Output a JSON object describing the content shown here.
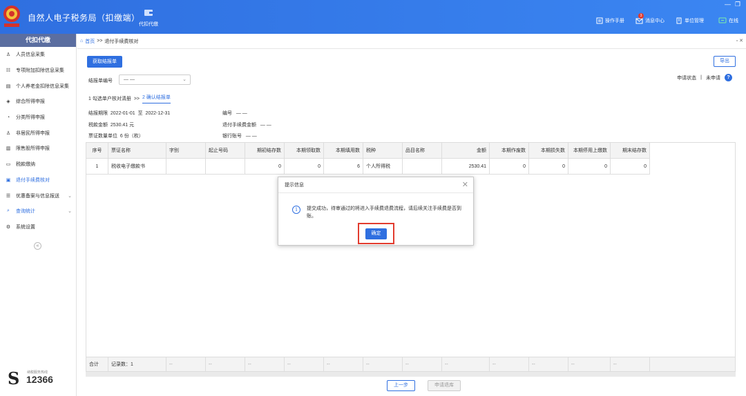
{
  "app": {
    "title": "自然人电子税务局（扣缴端）",
    "nav_tab": "代扣代缴",
    "toolbar": [
      {
        "icon": "manual-icon",
        "label": "操作手册"
      },
      {
        "icon": "message-icon",
        "label": "消息中心",
        "badge": "3"
      },
      {
        "icon": "building-icon",
        "label": "单位管理"
      },
      {
        "icon": "online-icon",
        "label": "在线"
      }
    ],
    "colors": {
      "primary": "#2f6fe0",
      "sidebar_header": "#5b6ea0",
      "highlight": "#e23b2e"
    }
  },
  "sidebar": {
    "header": "代扣代缴",
    "items": [
      {
        "label": "人员信息采集",
        "icon": "person-icon"
      },
      {
        "label": "专项附加扣除信息采集",
        "icon": "list-icon"
      },
      {
        "label": "个人养老金扣除信息采集",
        "icon": "document-icon"
      },
      {
        "label": "综合所得申报",
        "icon": "layers-icon"
      },
      {
        "label": "分类所得申报",
        "icon": "pie-icon"
      },
      {
        "label": "非居民所得申报",
        "icon": "user-icon"
      },
      {
        "label": "限售股所得申报",
        "icon": "bar-chart-icon"
      },
      {
        "label": "税款缴纳",
        "icon": "folder-icon"
      },
      {
        "label": "退付手续费核对",
        "icon": "receipt-icon",
        "active": true
      },
      {
        "label": "优惠备案与信息报送",
        "icon": "list-check-icon",
        "expandable": true
      },
      {
        "label": "查询统计",
        "icon": "query-icon",
        "expandable": true,
        "active": true
      },
      {
        "label": "系统设置",
        "icon": "gear-icon"
      }
    ],
    "hotline_label": "纳税服务热线",
    "hotline_number": "12366"
  },
  "breadcrumb": {
    "home": "首页",
    "separator": ">>",
    "current": "退付手续费核对"
  },
  "buttons": {
    "get_report": "获取结报单",
    "export": "导出",
    "prev": "上一步",
    "apply": "申请退库"
  },
  "filter": {
    "label": "结报单编号",
    "value": "— —"
  },
  "status": {
    "label": "申请状态",
    "separator": "|",
    "value": "未申请"
  },
  "steps": {
    "step1": "1 勾选单户核对清册",
    "sep": ">>",
    "step2": "2 确认结报单"
  },
  "info": {
    "period_label": "结报期限",
    "period_start": "2022-01-01",
    "period_to": "至",
    "period_end": "2022-12-31",
    "tax_label": "税款金额",
    "tax_value": "2530.41 元",
    "units_label": "票证数量单位",
    "units_value": "6 份（枚）",
    "number_label": "编号",
    "number_value": "— —",
    "refund_label": "退付手续费金额",
    "refund_value": "— —",
    "bank_label": "银行账号",
    "bank_value": "— —"
  },
  "table": {
    "headers": [
      "序号",
      "票证名称",
      "字别",
      "起止号码",
      "期初结存数",
      "本期领取数",
      "本期填用数",
      "税种",
      "品目名称",
      "金额",
      "本期作废数",
      "本期损失数",
      "本期停用上缴数",
      "期末结存数"
    ],
    "rows": [
      [
        "1",
        "税收电子缴款书",
        "",
        "",
        "0",
        "0",
        "6",
        "个人所得税",
        "",
        "2530.41",
        "0",
        "0",
        "0",
        "0"
      ]
    ],
    "footer": [
      "合计",
      "记录数：1",
      "--",
      "--",
      "--",
      "--",
      "--",
      "--",
      "--",
      "--",
      "--",
      "--",
      "--",
      "--"
    ]
  },
  "dialog": {
    "title": "提示信息",
    "message": "提交成功，待审通过的将进入手续费退费流程，请后续关注手续费是否到账。",
    "ok": "确定"
  }
}
